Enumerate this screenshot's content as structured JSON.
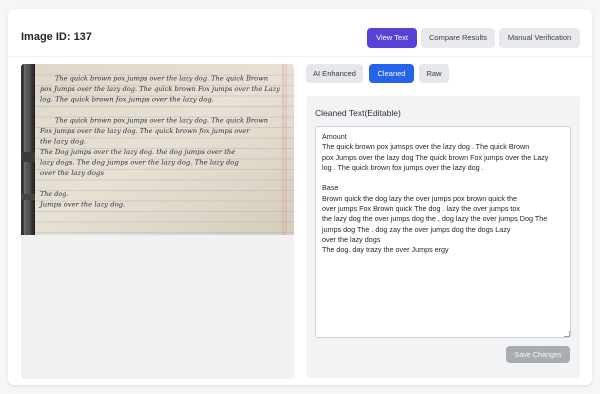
{
  "header": {
    "image_id": "Image ID: 137",
    "buttons": {
      "view_text": "View Text",
      "compare_results": "Compare Results",
      "manual_verification": "Manual Verification"
    }
  },
  "tabs": {
    "ai_enhanced": "AI Enhanced",
    "cleaned": "Cleaned",
    "raw": "Raw",
    "active": "Cleaned"
  },
  "editor": {
    "label": "Cleaned Text(Editable)",
    "content": "Amount\nThe quick brown pox jumsps over the lazy dog . The quick Brown\npox Jumps over the lazy dog The quick brown Fox jumps over the Lazy\nlog . The quick brown fox jumps over the lazy dog .\n\nBase\nBrown quick the dog lazy the over jumps pox brown quick the\nover jumps Fox Brown quick The dog . lazy the over jumps tox\nthe lazy dog the over jumps dog the , dog lazy the over jumps Dog The\njumps dog The . dog zay the over jumps dog the dogs Lazy\nover the lazy dogs\nThe dog. day trazy the over Jumps ergy",
    "save_label": "Save Changes"
  },
  "handwriting": {
    "lines": [
      "The quick brown pox jumps over the lazy dog. The quick Brown",
      "pox Jumps over the lazy dog. The quick brown Fox jumps over the Lazy",
      "log. The quick brown fox jumps over the lazy dog.",
      "",
      "The quick brown pox jumps over the lazy dog. The quick Brown",
      "Fox jumps over the lazy dog. The quick brown fox jumps over",
      "the lazy dog.",
      "The Dog jumps over the lazy dog. the dog jumps over the",
      "lazy dogs. The dog jumps over the lazy dog. The lazy dog",
      "over the lazy dogs",
      "",
      "The dog.",
      "Jumps over the lazy dog."
    ]
  },
  "colors": {
    "primary": "#5643d6",
    "tab_active": "#2563eb",
    "save_disabled": "#a9adb3"
  }
}
